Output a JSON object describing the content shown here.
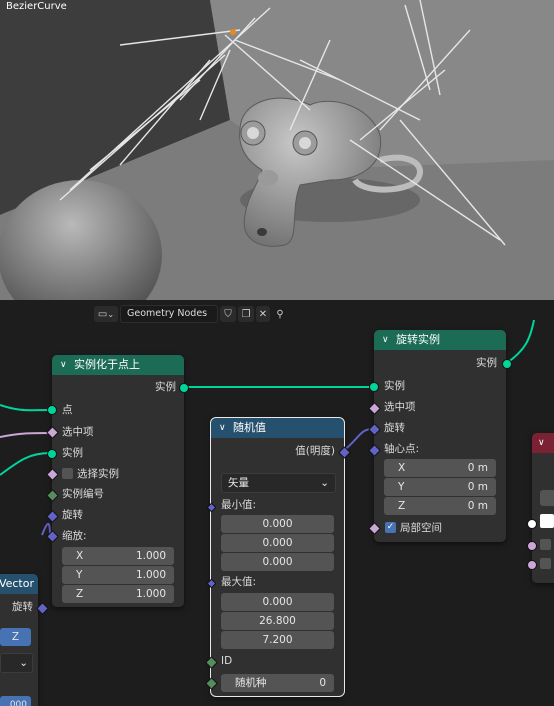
{
  "viewport": {
    "object_label": "BezierCurve"
  },
  "toolbar": {
    "node_tree_name": "Geometry Nodes"
  },
  "node_instance_on_points": {
    "title": "实例化于点上",
    "out_instances": "实例",
    "in_points": "点",
    "in_selection": "选中项",
    "in_instance": "实例",
    "in_pick_instance": "选择实例",
    "in_instance_index": "实例编号",
    "in_rotation": "旋转",
    "in_scale": "缩放:",
    "scale": [
      {
        "axis": "X",
        "value": "1.000"
      },
      {
        "axis": "Y",
        "value": "1.000"
      },
      {
        "axis": "Z",
        "value": "1.000"
      }
    ]
  },
  "node_random_value": {
    "title": "随机值",
    "out_value": "值(明度)",
    "type_select": "矢量",
    "min_label": "最小值:",
    "min": [
      "0.000",
      "0.000",
      "0.000"
    ],
    "max_label": "最大值:",
    "max": [
      "0.000",
      "26.800",
      "7.200"
    ],
    "id_label": "ID",
    "seed_label": "随机种",
    "seed_value": "0"
  },
  "node_rotate_instances": {
    "title": "旋转实例",
    "out_instances": "实例",
    "in_instances": "实例",
    "in_selection": "选中项",
    "in_rotation": "旋转",
    "in_pivot": "轴心点:",
    "pivot": [
      {
        "axis": "X",
        "value": "0 m"
      },
      {
        "axis": "Y",
        "value": "0 m"
      },
      {
        "axis": "Z",
        "value": "0 m"
      }
    ],
    "local_space": "局部空间"
  },
  "node_vector_partial": {
    "title": "Vector",
    "out_rotation": "旋转",
    "z_button": "Z",
    "value_partial": "000"
  },
  "colors": {
    "geometry_socket": "#00d69a",
    "vector_socket": "#6363c7",
    "bool_socket": "#cca6d6",
    "int_socket": "#598c5c",
    "header_green": "#1c6b55",
    "header_blue": "#25516f",
    "header_red": "#7a2233",
    "accent_blue": "#4772b3"
  }
}
